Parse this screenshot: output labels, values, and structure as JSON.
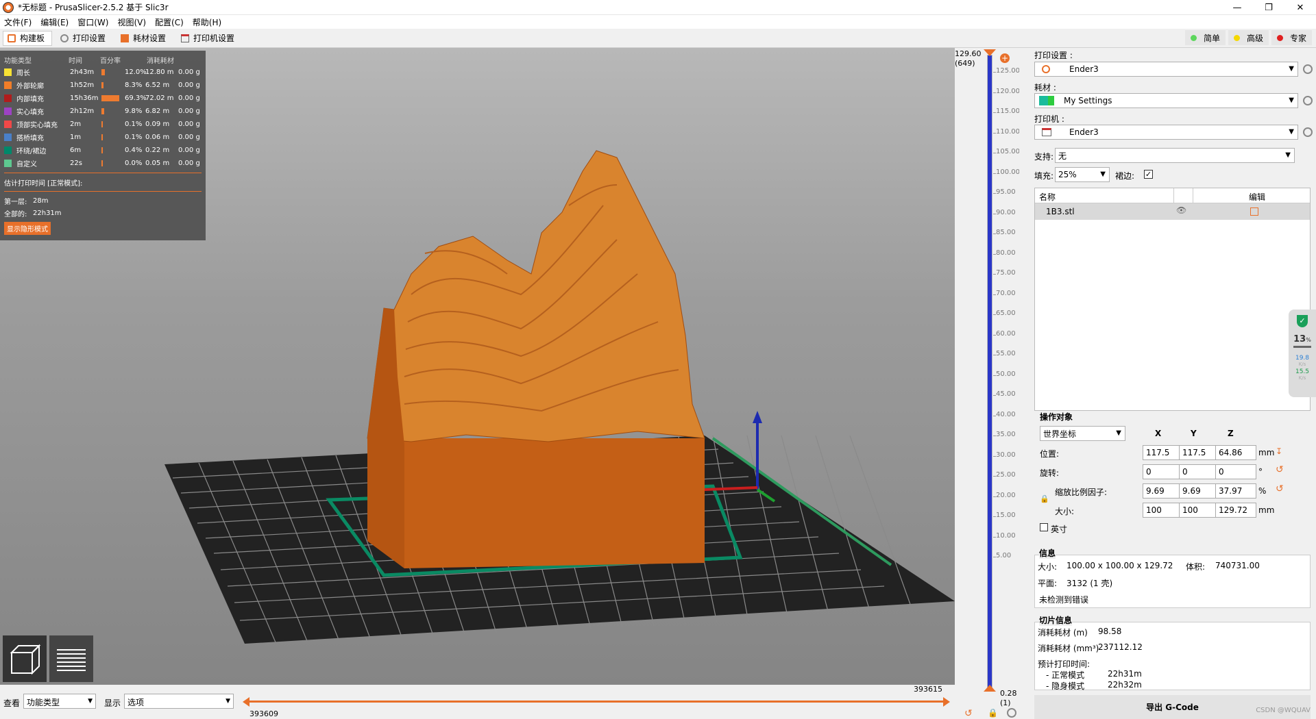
{
  "window": {
    "title": "*无标题 - PrusaSlicer-2.5.2 基于 Slic3r",
    "controls": [
      "—",
      "❐",
      "✕"
    ]
  },
  "menu": [
    "文件(F)",
    "编辑(E)",
    "窗口(W)",
    "视图(V)",
    "配置(C)",
    "帮助(H)"
  ],
  "tabs": [
    {
      "label": "构建板"
    },
    {
      "label": "打印设置"
    },
    {
      "label": "耗材设置"
    },
    {
      "label": "打印机设置"
    }
  ],
  "modes": [
    {
      "label": "简单",
      "color": "#5cd65c"
    },
    {
      "label": "高级",
      "color": "#f5d800"
    },
    {
      "label": "专家",
      "color": "#e02020"
    }
  ],
  "legend": {
    "headers": [
      "功能类型",
      "时间",
      "百分率",
      "消耗耗材"
    ],
    "rows": [
      {
        "name": "周长",
        "color": "#f7e234",
        "time": "2h43m",
        "pct": "12.0%",
        "pct_value": 12.0,
        "len": "12.80 m",
        "weight": "0.00 g"
      },
      {
        "name": "外部轮廓",
        "color": "#f07d28",
        "time": "1h52m",
        "pct": "8.3%",
        "pct_value": 8.3,
        "len": "6.52 m",
        "weight": "0.00 g"
      },
      {
        "name": "内部填充",
        "color": "#b01c1c",
        "time": "15h36m",
        "pct": "69.3%",
        "pct_value": 69.3,
        "len": "72.02 m",
        "weight": "0.00 g"
      },
      {
        "name": "实心填充",
        "color": "#9d42c4",
        "time": "2h12m",
        "pct": "9.8%",
        "pct_value": 9.8,
        "len": "6.82 m",
        "weight": "0.00 g"
      },
      {
        "name": "顶部实心填充",
        "color": "#f04848",
        "time": "2m",
        "pct": "0.1%",
        "pct_value": 0.1,
        "len": "0.09 m",
        "weight": "0.00 g"
      },
      {
        "name": "搭桥填充",
        "color": "#4a80c8",
        "time": "1m",
        "pct": "0.1%",
        "pct_value": 0.1,
        "len": "0.06 m",
        "weight": "0.00 g"
      },
      {
        "name": "环绕/裙边",
        "color": "#00886a",
        "time": "6m",
        "pct": "0.4%",
        "pct_value": 0.4,
        "len": "0.22 m",
        "weight": "0.00 g"
      },
      {
        "name": "自定义",
        "color": "#5ec890",
        "time": "22s",
        "pct": "0.0%",
        "pct_value": 0.0,
        "len": "0.05 m",
        "weight": "0.00 g"
      }
    ],
    "est_title": "估计打印时间 [正常模式]:",
    "first_layer_label": "第一层:",
    "first_layer": "28m",
    "total_label": "全部的:",
    "total": "22h31m",
    "stealth_button": "显示隐形模式"
  },
  "vslider": {
    "top_value": "129.60",
    "top_layer": "(649)",
    "bottom_value": "0.28",
    "bottom_layer": "(1)",
    "ticks": [
      "125.00",
      "120.00",
      "115.00",
      "110.00",
      "105.00",
      "100.00",
      "95.00",
      "90.00",
      "85.00",
      "80.00",
      "75.00",
      "70.00",
      "65.00",
      "60.00",
      "55.00",
      "50.00",
      "45.00",
      "40.00",
      "35.00",
      "30.00",
      "25.00",
      "20.00",
      "15.00",
      "10.00",
      "5.00"
    ],
    "fill_fraction": 1.0
  },
  "bottombar": {
    "view_label": "查看",
    "view_value": "功能类型",
    "show_label": "显示",
    "show_value": "选项",
    "hslider_right": "393615",
    "hslider_left": "393609"
  },
  "panel": {
    "print_settings_label": "打印设置 :",
    "print_settings_value": "Ender3",
    "filament_label": "耗材 :",
    "filament_value": "My Settings",
    "printer_label": "打印机 :",
    "printer_value": "Ender3",
    "support_label": "支持:",
    "support_value": "无",
    "infill_label": "填充:",
    "infill_value": "25%",
    "brim_label": "裙边:",
    "objlist": {
      "col_name": "名称",
      "col_edit": "编辑",
      "item": "1B3.stl"
    },
    "manip": {
      "title": "操作对象",
      "coord": "世界坐标",
      "axes": [
        "X",
        "Y",
        "Z"
      ],
      "position_label": "位置:",
      "position": [
        "117.5",
        "117.5",
        "64.86"
      ],
      "position_unit": "mm",
      "rotation_label": "旋转:",
      "rotation": [
        "0",
        "0",
        "0"
      ],
      "rotation_unit": "°",
      "scale_label": "缩放比例因子:",
      "scale": [
        "9.69",
        "9.69",
        "37.97"
      ],
      "scale_unit": "%",
      "size_label": "大小:",
      "size": [
        "100",
        "100",
        "129.72"
      ],
      "size_unit": "mm",
      "inch_label": "英寸"
    },
    "info": {
      "title": "信息",
      "size_label": "大小:",
      "size_value": "100.00 x 100.00 x 129.72",
      "volume_label": "体积:",
      "volume_value": "740731.00",
      "facets_label": "平面:",
      "facets_value": "3132 (1 壳)",
      "errors": "未检测到错误"
    },
    "slice": {
      "title": "切片信息",
      "used_m_label": "消耗耗材 (m)",
      "used_m": "98.58",
      "used_mm3_label": "消耗耗材 (mm³)",
      "used_mm3": "237112.12",
      "est_label": "预计打印时间:",
      "normal_label": "- 正常模式",
      "normal": "22h31m",
      "stealth_label": "- 隐身模式",
      "stealth": "22h32m"
    },
    "export_button": "导出 G-Code",
    "net": {
      "pct": "13",
      "pct_unit": "%",
      "up": "19.8",
      "down": "15.5",
      "rate_unit": "K/s"
    }
  },
  "watermark": "CSDN @WQUAV"
}
